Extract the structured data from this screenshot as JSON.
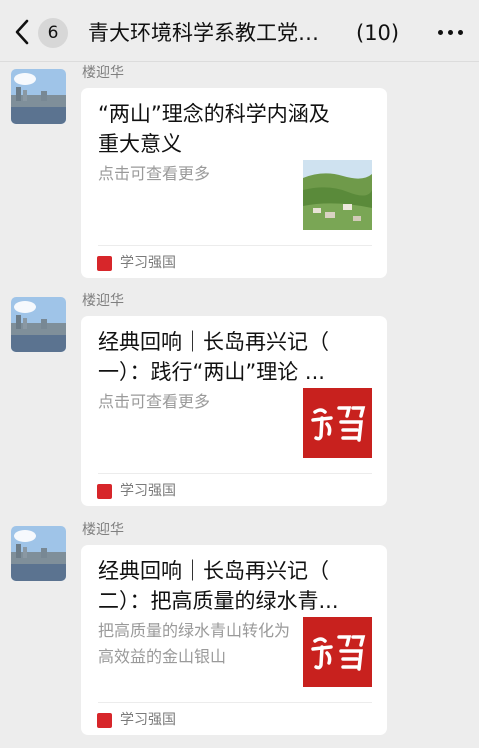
{
  "header": {
    "unread_count": "6",
    "title": "青大环境科学系教工党…",
    "member_count": "(10)"
  },
  "messages": [
    {
      "sender": "楼迎华",
      "card": {
        "title_lines": [
          "“两山”理念的科学内涵及",
          "重大意义"
        ],
        "description": "点击可查看更多",
        "thumbnail": "landscape-photo",
        "source": "学习强国"
      }
    },
    {
      "sender": "楼迎华",
      "card": {
        "title_lines": [
          "经典回响｜长岛再兴记（",
          "一）：践行“两山”理论 ..."
        ],
        "description": "点击可查看更多",
        "thumbnail": "xuexi-logo",
        "source": "学习强国"
      }
    },
    {
      "sender": "楼迎华",
      "card": {
        "title_lines": [
          "经典回响｜长岛再兴记（",
          "二）：把高质量的绿水青..."
        ],
        "description": "把高质量的绿水青山转化为高效益的金山银山",
        "thumbnail": "xuexi-logo",
        "source": "学习强国"
      }
    }
  ],
  "colors": {
    "background": "#ededed",
    "card": "#ffffff",
    "source_icon": "#d7262a",
    "logo_red": "#c8211e"
  }
}
